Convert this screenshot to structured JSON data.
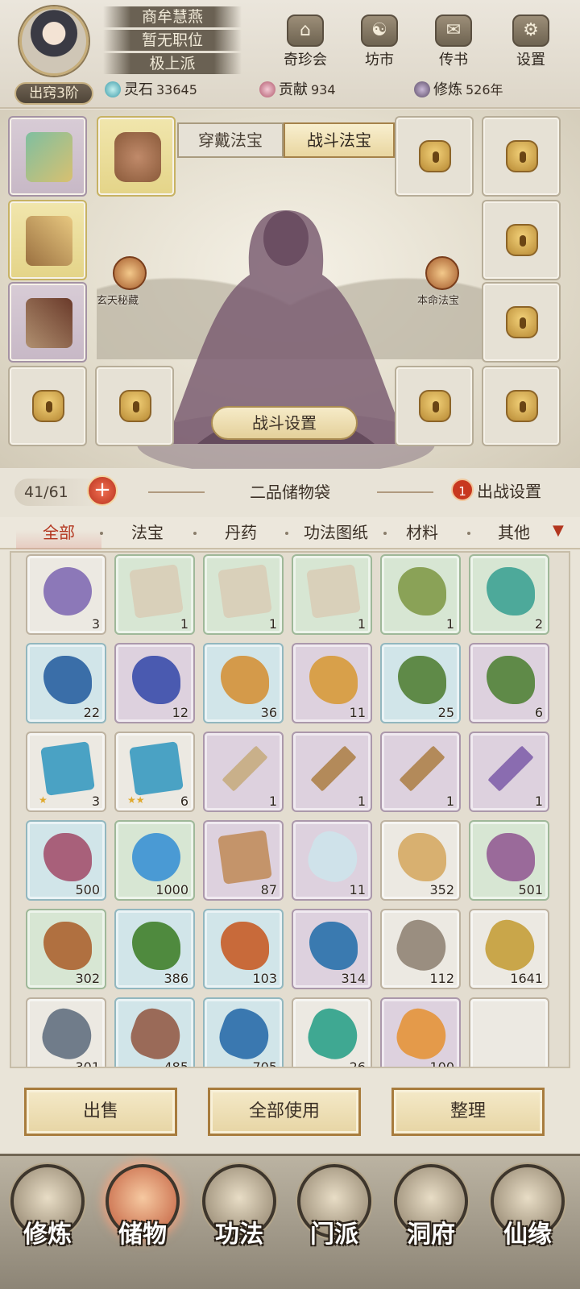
{
  "player": {
    "name": "商牟慧燕",
    "position": "暂无职位",
    "sect": "极上派",
    "realm": "出窍3阶"
  },
  "top_menu": [
    {
      "label": "奇珍会",
      "icon": "treasure-pavilion-icon"
    },
    {
      "label": "坊市",
      "icon": "market-icon"
    },
    {
      "label": "传书",
      "icon": "scroll-letter-icon"
    },
    {
      "label": "设置",
      "icon": "gear-icon"
    }
  ],
  "stats": {
    "spirit_stone_label": "灵石",
    "spirit_stone": "33645",
    "contribution_label": "贡献",
    "contribution": "934",
    "cultivation_label": "修炼",
    "cultivation": "526年"
  },
  "equip": {
    "tab_wear": "穿戴法宝",
    "tab_battle": "战斗法宝",
    "left_skill": "玄天秘藏",
    "right_skill": "本命法宝",
    "battle_settings": "战斗设置"
  },
  "bag": {
    "capacity": "41/61",
    "add_symbol": "+",
    "title": "二品储物袋",
    "deploy_count": "1",
    "deploy_label": "出战设置"
  },
  "categories": [
    "全部",
    "法宝",
    "丹药",
    "功法图纸",
    "材料",
    "其他"
  ],
  "items": [
    {
      "name": "orb",
      "rarity": "white",
      "count": "3",
      "color": "#8c78b8"
    },
    {
      "name": "manual",
      "rarity": "green",
      "count": "1",
      "color": "#d9d0ba"
    },
    {
      "name": "manual",
      "rarity": "green",
      "count": "1",
      "color": "#d9d0ba"
    },
    {
      "name": "manual",
      "rarity": "green",
      "count": "1",
      "color": "#d9d0ba"
    },
    {
      "name": "seeds",
      "rarity": "green",
      "count": "1",
      "color": "#8aa257"
    },
    {
      "name": "vase",
      "rarity": "green",
      "count": "2",
      "color": "#4da99a"
    },
    {
      "name": "blue-flower",
      "rarity": "blue",
      "count": "22",
      "color": "#3a6ea8"
    },
    {
      "name": "blue-flower",
      "rarity": "purple",
      "count": "12",
      "color": "#4a5ab0"
    },
    {
      "name": "grass",
      "rarity": "blue",
      "count": "36",
      "color": "#d49a4a"
    },
    {
      "name": "grass",
      "rarity": "purple",
      "count": "11",
      "color": "#d8a04a"
    },
    {
      "name": "herb",
      "rarity": "blue",
      "count": "25",
      "color": "#5f8a48"
    },
    {
      "name": "herb",
      "rarity": "purple",
      "count": "6",
      "color": "#5f8a48"
    },
    {
      "name": "scroll",
      "rarity": "white",
      "count": "3",
      "color": "#4aa2c4",
      "stars": "★"
    },
    {
      "name": "scroll",
      "rarity": "white",
      "count": "6",
      "color": "#4aa2c4",
      "stars": "★★"
    },
    {
      "name": "sabre",
      "rarity": "purple",
      "count": "1",
      "color": "#c9b08a"
    },
    {
      "name": "sword",
      "rarity": "purple",
      "count": "1",
      "color": "#b38a5a"
    },
    {
      "name": "sword",
      "rarity": "purple",
      "count": "1",
      "color": "#b38a5a"
    },
    {
      "name": "scissors",
      "rarity": "purple",
      "count": "1",
      "color": "#8a6cb0"
    },
    {
      "name": "powder",
      "rarity": "blue",
      "count": "500",
      "color": "#a8607a"
    },
    {
      "name": "water-drop",
      "rarity": "green",
      "count": "1000",
      "color": "#4a9ad4"
    },
    {
      "name": "token",
      "rarity": "purple",
      "count": "87",
      "color": "#c4946a"
    },
    {
      "name": "crystal",
      "rarity": "purple",
      "count": "11",
      "color": "#cfe2ea"
    },
    {
      "name": "ginseng",
      "rarity": "white",
      "count": "352",
      "color": "#d8b070"
    },
    {
      "name": "lotus-root",
      "rarity": "green",
      "count": "501",
      "color": "#9a6a9a"
    },
    {
      "name": "root",
      "rarity": "green",
      "count": "302",
      "color": "#b07040"
    },
    {
      "name": "white-flower",
      "rarity": "blue",
      "count": "386",
      "color": "#4f8a3e"
    },
    {
      "name": "berry-branch",
      "rarity": "blue",
      "count": "103",
      "color": "#c86a3a"
    },
    {
      "name": "fruit-branch",
      "rarity": "purple",
      "count": "314",
      "color": "#3a7ab0"
    },
    {
      "name": "stone",
      "rarity": "white",
      "count": "112",
      "color": "#9a8e80"
    },
    {
      "name": "gold-ore",
      "rarity": "white",
      "count": "1641",
      "color": "#c9a64a"
    },
    {
      "name": "iron-ore",
      "rarity": "white",
      "count": "301",
      "color": "#707c8a"
    },
    {
      "name": "red-rock",
      "rarity": "blue",
      "count": "485",
      "color": "#9a6a58"
    },
    {
      "name": "blue-rock",
      "rarity": "blue",
      "count": "705",
      "color": "#3a78b0"
    },
    {
      "name": "jade",
      "rarity": "white",
      "count": "26",
      "color": "#3fa892"
    },
    {
      "name": "amber",
      "rarity": "purple",
      "count": "100",
      "color": "#e49a4a"
    },
    {
      "name": "empty",
      "rarity": "white",
      "count": "",
      "color": "#e6e3dc"
    }
  ],
  "actions": [
    "出售",
    "全部使用",
    "整理"
  ],
  "nav": [
    "修炼",
    "储物",
    "功法",
    "门派",
    "洞府",
    "仙缘"
  ]
}
